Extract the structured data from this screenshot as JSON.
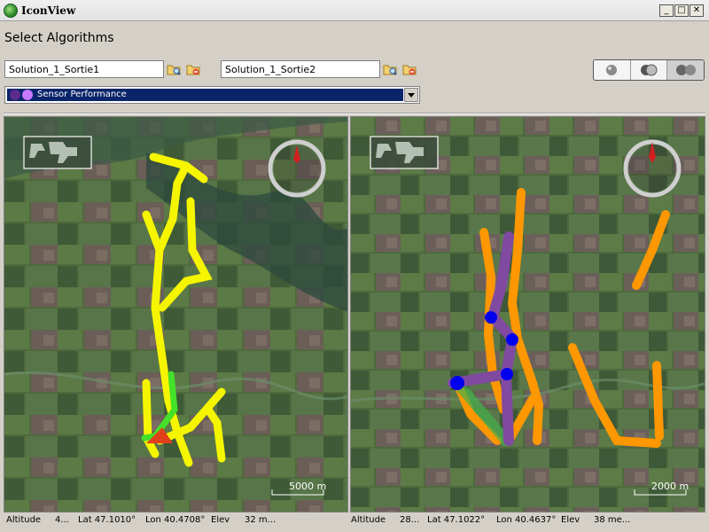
{
  "window": {
    "title": "IconView",
    "minimize": "_",
    "maximize": "□",
    "close": "✕"
  },
  "heading": "Select Algorithms",
  "solutions": [
    {
      "value": "Solution_1_Sortie1"
    },
    {
      "value": "Solution_1_Sortie2"
    }
  ],
  "metric": {
    "selected": "Sensor Performance"
  },
  "maps": [
    {
      "scale_label": "5000 m"
    },
    {
      "scale_label": "2000 m"
    }
  ],
  "status": [
    {
      "altitude_label": "Altitude",
      "altitude_value": "4...",
      "lat": "Lat 47.1010°",
      "lon": "Lon 40.4708°",
      "elev_label": "Elev",
      "elev_value": "32 m..."
    },
    {
      "altitude_label": "Altitude",
      "altitude_value": "28...",
      "lat": "Lat 47.1022°",
      "lon": "Lon 40.4637°",
      "elev_label": "Elev",
      "elev_value": "38 me..."
    }
  ],
  "colors": {
    "track_yellow": "#f5f500",
    "track_green": "#45e028",
    "track_orange": "#ff9700",
    "track_purple": "#7f4aa0",
    "track_blue": "#0000ee",
    "selection": "#0a246a",
    "compass_needle": "#d02020"
  },
  "icons": [
    "globe-app-icon",
    "folder-search-icon",
    "folder-remove-icon",
    "sphere-toggle-icon",
    "compass-icon",
    "world-minimap-icon"
  ]
}
